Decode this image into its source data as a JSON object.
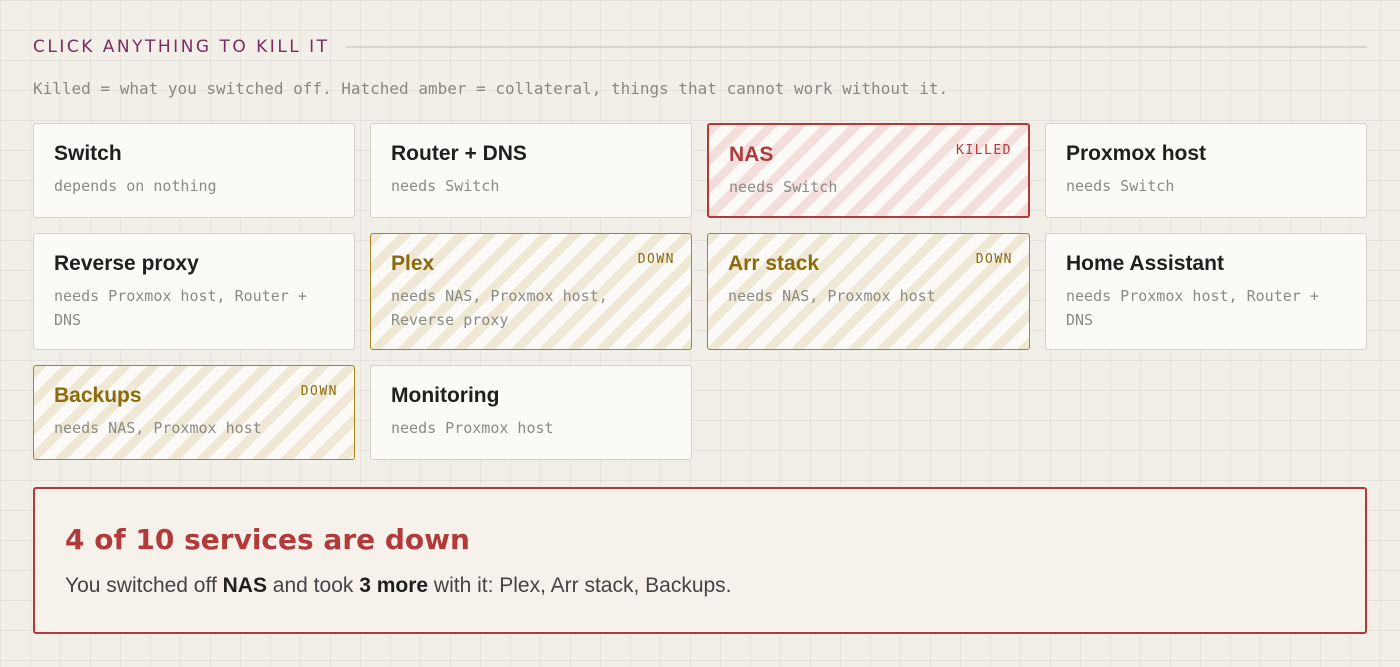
{
  "header": {
    "title": "CLICK ANYTHING TO KILL IT",
    "legend": "Killed = what you switched off. Hatched amber = collateral, things that cannot work without it."
  },
  "services": [
    {
      "name": "Switch",
      "deps": "depends on nothing",
      "state": "up",
      "badge": ""
    },
    {
      "name": "Router + DNS",
      "deps": "needs Switch",
      "state": "up",
      "badge": ""
    },
    {
      "name": "NAS",
      "deps": "needs Switch",
      "state": "killed",
      "badge": "KILLED"
    },
    {
      "name": "Proxmox host",
      "deps": "needs Switch",
      "state": "up",
      "badge": ""
    },
    {
      "name": "Reverse proxy",
      "deps": "needs Proxmox host, Router + DNS",
      "state": "up",
      "badge": ""
    },
    {
      "name": "Plex",
      "deps": "needs NAS, Proxmox host, Reverse proxy",
      "state": "down",
      "badge": "DOWN"
    },
    {
      "name": "Arr stack",
      "deps": "needs NAS, Proxmox host",
      "state": "down",
      "badge": "DOWN"
    },
    {
      "name": "Home Assistant",
      "deps": "needs Proxmox host, Router + DNS",
      "state": "up",
      "badge": ""
    },
    {
      "name": "Backups",
      "deps": "needs NAS, Proxmox host",
      "state": "down",
      "badge": "DOWN"
    },
    {
      "name": "Monitoring",
      "deps": "needs Proxmox host",
      "state": "up",
      "badge": ""
    }
  ],
  "summary": {
    "title": "4 of 10 services are down",
    "text_prefix": "You switched off ",
    "killed_name": "NAS",
    "text_middle": " and took ",
    "more_count": "3 more",
    "text_suffix": " with it: Plex, Arr stack, Backups."
  },
  "colors": {
    "killed": "#b33a3a",
    "down": "#a8861a",
    "header": "#7a2d5e"
  }
}
